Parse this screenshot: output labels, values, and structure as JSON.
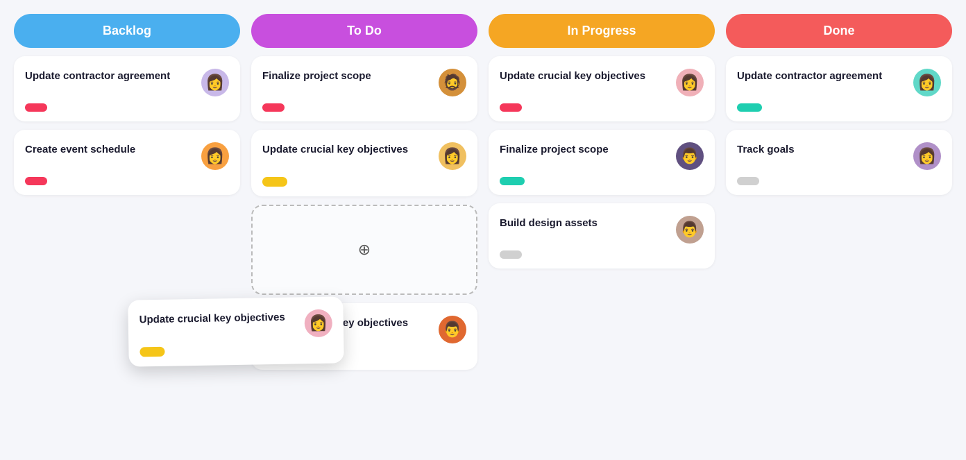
{
  "columns": [
    {
      "id": "backlog",
      "label": "Backlog",
      "headerClass": "col-backlog",
      "cards": [
        {
          "id": "b1",
          "title": "Update contractor agreement",
          "tagClass": "tag-red",
          "avatarEmoji": "👩",
          "avatarBg": "#c8b8e8"
        },
        {
          "id": "b2",
          "title": "Create event schedule",
          "tagClass": "tag-red",
          "avatarEmoji": "👩",
          "avatarBg": "#f8a040"
        }
      ]
    },
    {
      "id": "todo",
      "label": "To Do",
      "headerClass": "col-todo",
      "cards": [
        {
          "id": "t1",
          "title": "Finalize project scope",
          "tagClass": "tag-red",
          "avatarEmoji": "🧔",
          "avatarBg": "#d4903a"
        },
        {
          "id": "t2",
          "title": "Update crucial key objectives",
          "tagClass": "tag-yellow",
          "avatarEmoji": "👩",
          "avatarBg": "#f0c060"
        },
        {
          "id": "t3-dropzone",
          "isDrop": true
        },
        {
          "id": "t4",
          "title": "Update crucial key objectives",
          "tagClass": "tag-yellow",
          "avatarEmoji": "👨",
          "avatarBg": "#e06830"
        }
      ]
    },
    {
      "id": "inprogress",
      "label": "In Progress",
      "headerClass": "col-inprogress",
      "cards": [
        {
          "id": "ip1",
          "title": "Update crucial key objectives",
          "tagClass": "tag-red",
          "avatarEmoji": "👩",
          "avatarBg": "#f0b0b8"
        },
        {
          "id": "ip2",
          "title": "Finalize project scope",
          "tagClass": "tag-green",
          "avatarEmoji": "👨",
          "avatarBg": "#605080"
        },
        {
          "id": "ip3",
          "title": "Build design assets",
          "tagClass": "tag-gray",
          "avatarEmoji": "👨",
          "avatarBg": "#c0a090"
        }
      ]
    },
    {
      "id": "done",
      "label": "Done",
      "headerClass": "col-done",
      "cards": [
        {
          "id": "d1",
          "title": "Update contractor agreement",
          "tagClass": "tag-green",
          "avatarEmoji": "👩",
          "avatarBg": "#60d8c8"
        },
        {
          "id": "d2",
          "title": "Track goals",
          "tagClass": "tag-gray",
          "avatarEmoji": "👩",
          "avatarBg": "#b090c8"
        }
      ]
    }
  ],
  "draggingCard": {
    "title": "Update crucial key objectives",
    "tagClass": "tag-yellow",
    "avatarEmoji": "👩",
    "avatarBg": "#f0b0c0"
  },
  "moveIcon": "⊹"
}
